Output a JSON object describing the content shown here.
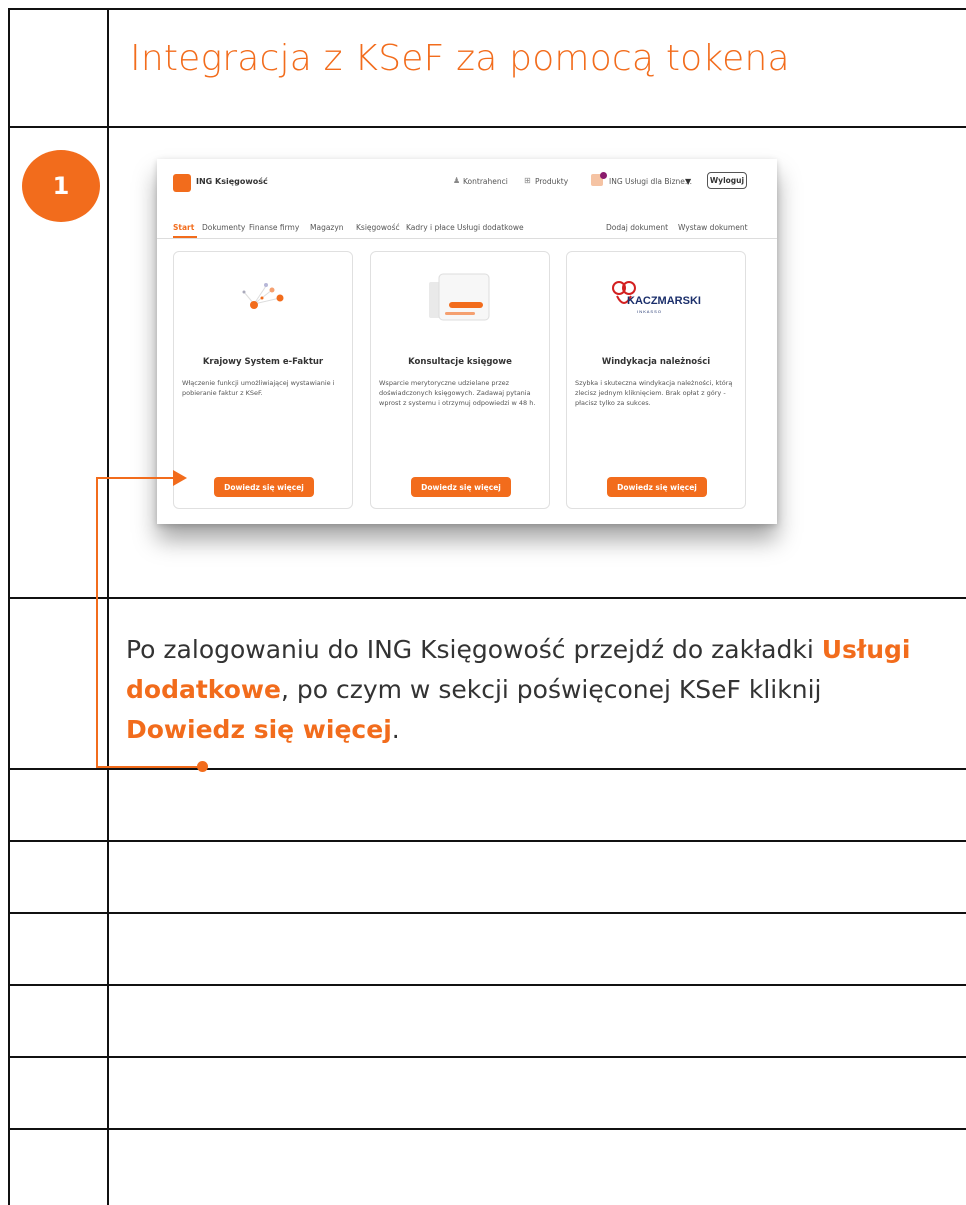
{
  "title": "Integracja z KSeF za pomocą tokena",
  "step_number": "1",
  "screenshot": {
    "brand": "ING Księgowość",
    "top_links": {
      "contractors": "Kontrahenci",
      "products": "Produkty",
      "user": "ING Usługi dla Bizne...",
      "logout": "Wyloguj"
    },
    "tabs": [
      "Start",
      "Dokumenty",
      "Finanse firmy",
      "Magazyn",
      "Księgowość",
      "Kadry i płace",
      "Usługi dodatkowe"
    ],
    "actions": [
      "Dodaj dokument",
      "Wystaw dokument"
    ],
    "cards": [
      {
        "title": "Krajowy System e-Faktur",
        "description": "Włączenie funkcji umożliwiającej wystawianie i pobieranie faktur z KSeF.",
        "button": "Dowiedz się więcej"
      },
      {
        "title": "Konsultacje księgowe",
        "description": "Wsparcie merytoryczne udzielane przez doświadczonych księgowych. Zadawaj pytania wprost z systemu i otrzymuj odpowiedzi w 48 h.",
        "button": "Dowiedz się więcej"
      },
      {
        "title": "Windykacja należności",
        "description": "Szybka i skuteczna windykacja należności, którą zlecisz jednym kliknięciem. Brak opłat z góry - płacisz tylko za sukces.",
        "button": "Dowiedz się więcej"
      }
    ],
    "partner_logo_text": "KACZMARSKI",
    "partner_logo_sub": "I N K A S S O"
  },
  "instruction": {
    "part1": "Po zalogowaniu do ING Księgowość przejdź do zakładki ",
    "highlight1": "Usługi dodatkowe",
    "part2": ", po czym w sekcji poświęconej KSeF kliknij ",
    "highlight2": "Dowiedz się więcej",
    "part3": "."
  },
  "colors": {
    "accent": "#f26c1c",
    "grid": "#111111"
  }
}
